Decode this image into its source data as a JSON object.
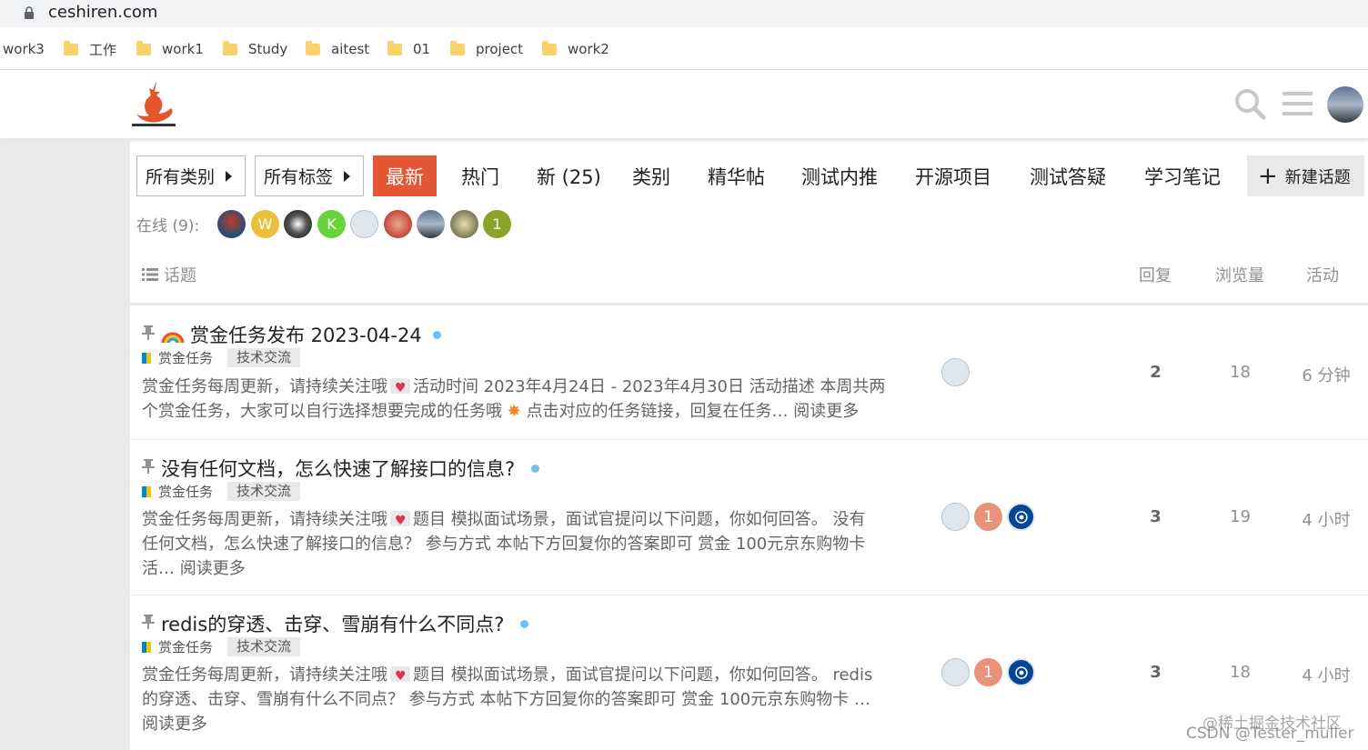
{
  "browser": {
    "url": "ceshiren.com",
    "bookmarks": [
      "work3",
      "工作",
      "work1",
      "Study",
      "aitest",
      "01",
      "project",
      "work2"
    ]
  },
  "nav": {
    "all_categories": "所有类别",
    "all_tags": "所有标签",
    "tabs": [
      "最新",
      "热门",
      "新 (25)",
      "类别",
      "精华帖",
      "测试内推",
      "开源项目",
      "测试答疑",
      "学习笔记"
    ],
    "new_topic": "新建话题"
  },
  "online": {
    "label": "在线 (9):",
    "avatars": [
      "",
      "W",
      "",
      "K",
      "",
      "",
      "",
      "",
      "1"
    ]
  },
  "table_header": {
    "topics": "话题",
    "replies": "回复",
    "views": "浏览量",
    "activity": "活动"
  },
  "topics": [
    {
      "title": "赏金任务发布 2023-04-24",
      "category": "赏金任务",
      "tag": "技术交流",
      "excerpt_line1": "赏金任务每周更新，请持续关注哦",
      "excerpt_line1b": "活动时间 2023年4月24日 - 2023年4月30日 活动描述 本周共两",
      "excerpt_line2": "个赏金任务，大家可以自行选择想要完成的任务哦",
      "excerpt_line2b": "点击对应的任务链接，回复在任务… 阅读更多",
      "replies": "2",
      "views": "18",
      "activity": "6 分钟"
    },
    {
      "title": "没有任何文档，怎么快速了解接口的信息?",
      "category": "赏金任务",
      "tag": "技术交流",
      "excerpt_line1": "赏金任务每周更新，请持续关注哦",
      "excerpt_line1b": "题目 模拟面试场景，面试官提问以下问题，你如何回答。 没有",
      "excerpt_line2": "任何文档，怎么快速了解接口的信息？ 参与方式 本帖下方回复你的答案即可 赏金 100元京东购物卡",
      "excerpt_line3": "活… 阅读更多",
      "poster_mid": "1",
      "replies": "3",
      "views": "19",
      "activity": "4 小时"
    },
    {
      "title": "redis的穿透、击穿、雪崩有什么不同点?",
      "category": "赏金任务",
      "tag": "技术交流",
      "excerpt_line1": "赏金任务每周更新，请持续关注哦",
      "excerpt_line1b": "题目 模拟面试场景，面试官提问以下问题，你如何回答。 redis",
      "excerpt_line2": "的穿透、击穿、雪崩有什么不同点？ 参与方式 本帖下方回复你的答案即可 赏金 100元京东购物卡 …",
      "excerpt_line3": "阅读更多",
      "poster_mid": "1",
      "replies": "3",
      "views": "18",
      "activity": "4 小时"
    }
  ],
  "watermark": {
    "line1": "@稀土掘金技术社区",
    "line2": "CSDN @Tester_muller"
  },
  "colors": {
    "accent": "#e45735",
    "unread": "#6fc1ec",
    "category_blue": "#0088cc",
    "category_yellow": "#f1c40f"
  }
}
